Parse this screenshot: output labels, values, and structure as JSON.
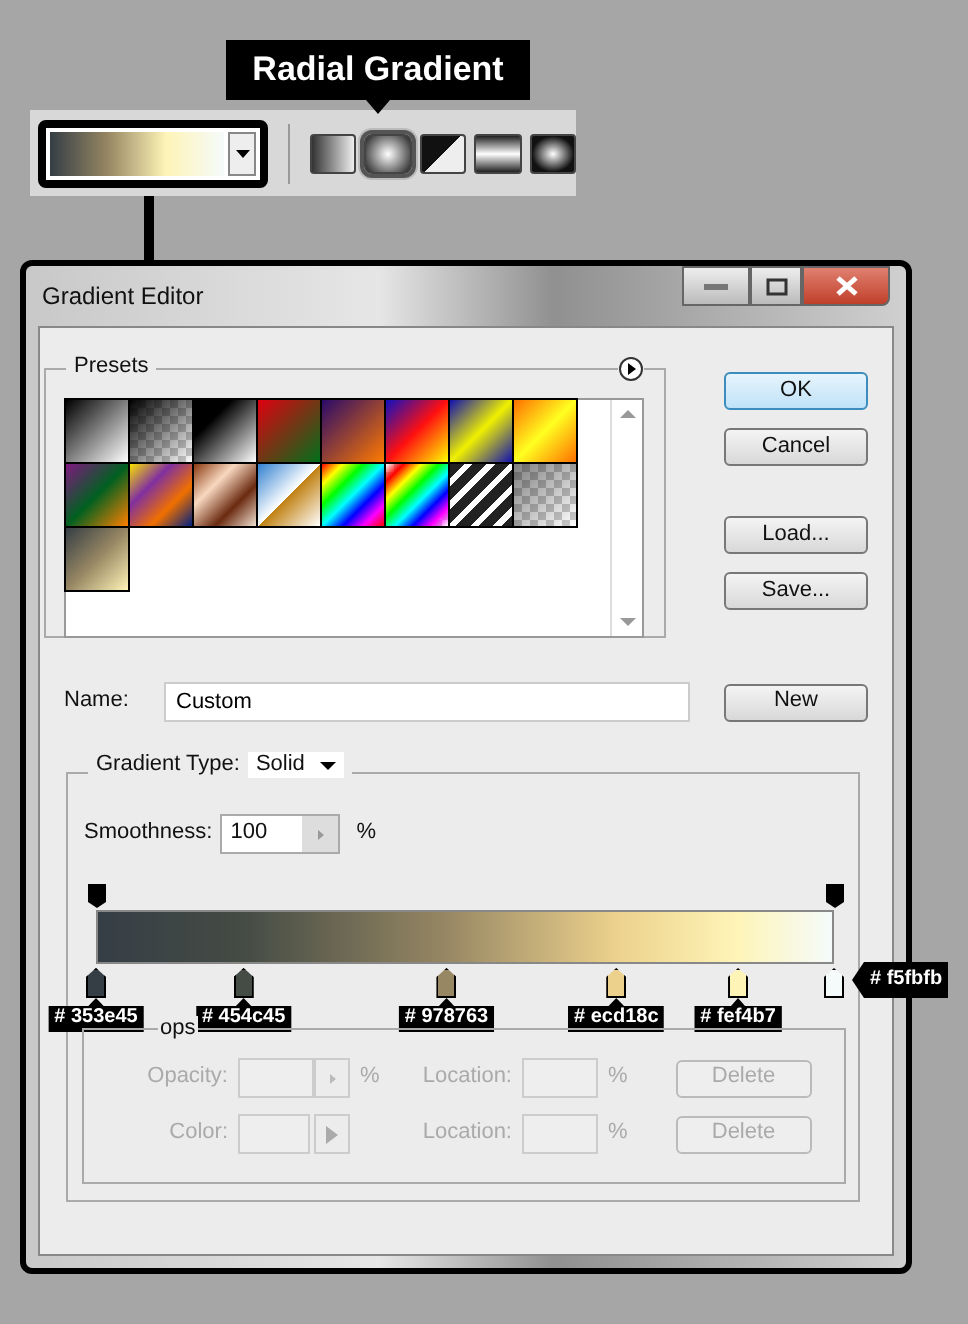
{
  "toolbar": {
    "style_buttons": [
      {
        "kind": "linear",
        "selected": false
      },
      {
        "kind": "radial",
        "selected": true
      },
      {
        "kind": "angle",
        "selected": false
      },
      {
        "kind": "reflected",
        "selected": false
      },
      {
        "kind": "diamond",
        "selected": false
      }
    ],
    "callout": "Radial Gradient"
  },
  "window": {
    "title": "Gradient Editor"
  },
  "presets": {
    "legend": "Presets"
  },
  "buttons": [
    {
      "label": "OK",
      "kind": "default"
    },
    {
      "label": "Cancel",
      "kind": "plain"
    },
    {
      "label": "Load...",
      "kind": "plain"
    },
    {
      "label": "Save...",
      "kind": "plain"
    }
  ],
  "name": {
    "label": "Name:",
    "value": "Custom",
    "button": "New"
  },
  "gradient": {
    "type_label": "Gradient Type:",
    "type_value": "Solid",
    "smoothness_label": "Smoothness:",
    "smoothness_value": "100",
    "smoothness_unit": "%",
    "opacity_stops": [
      {
        "level": 0
      },
      {
        "level": 1
      }
    ],
    "color_stops": [
      {
        "level": 0,
        "color": "#353e45",
        "label": "# 353e45",
        "kind": "below"
      },
      {
        "level": 0.2,
        "color": "#454c45",
        "label": "# 454c45",
        "kind": "below"
      },
      {
        "level": 0.475,
        "color": "#978763",
        "label": "# 978763",
        "kind": "below"
      },
      {
        "level": 0.705,
        "color": "#ecd18c",
        "label": "# ecd18c",
        "kind": "below"
      },
      {
        "level": 0.87,
        "color": "#fef4b7",
        "label": "# fef4b7",
        "kind": "below"
      },
      {
        "level": 1,
        "color": "#f5fbfb",
        "label": "# f5fbfb",
        "kind": "right"
      }
    ]
  },
  "stops": {
    "legend": "ops",
    "rows": [
      {
        "label": "Opacity:",
        "unit": "%",
        "location_label": "Location:",
        "location_unit": "%",
        "button": "Delete",
        "disabled": true,
        "kind": "stepper"
      },
      {
        "label": "Color:",
        "location_label": "Location:",
        "location_unit": "%",
        "button": "Delete",
        "disabled": true,
        "kind": "swatch"
      }
    ]
  }
}
